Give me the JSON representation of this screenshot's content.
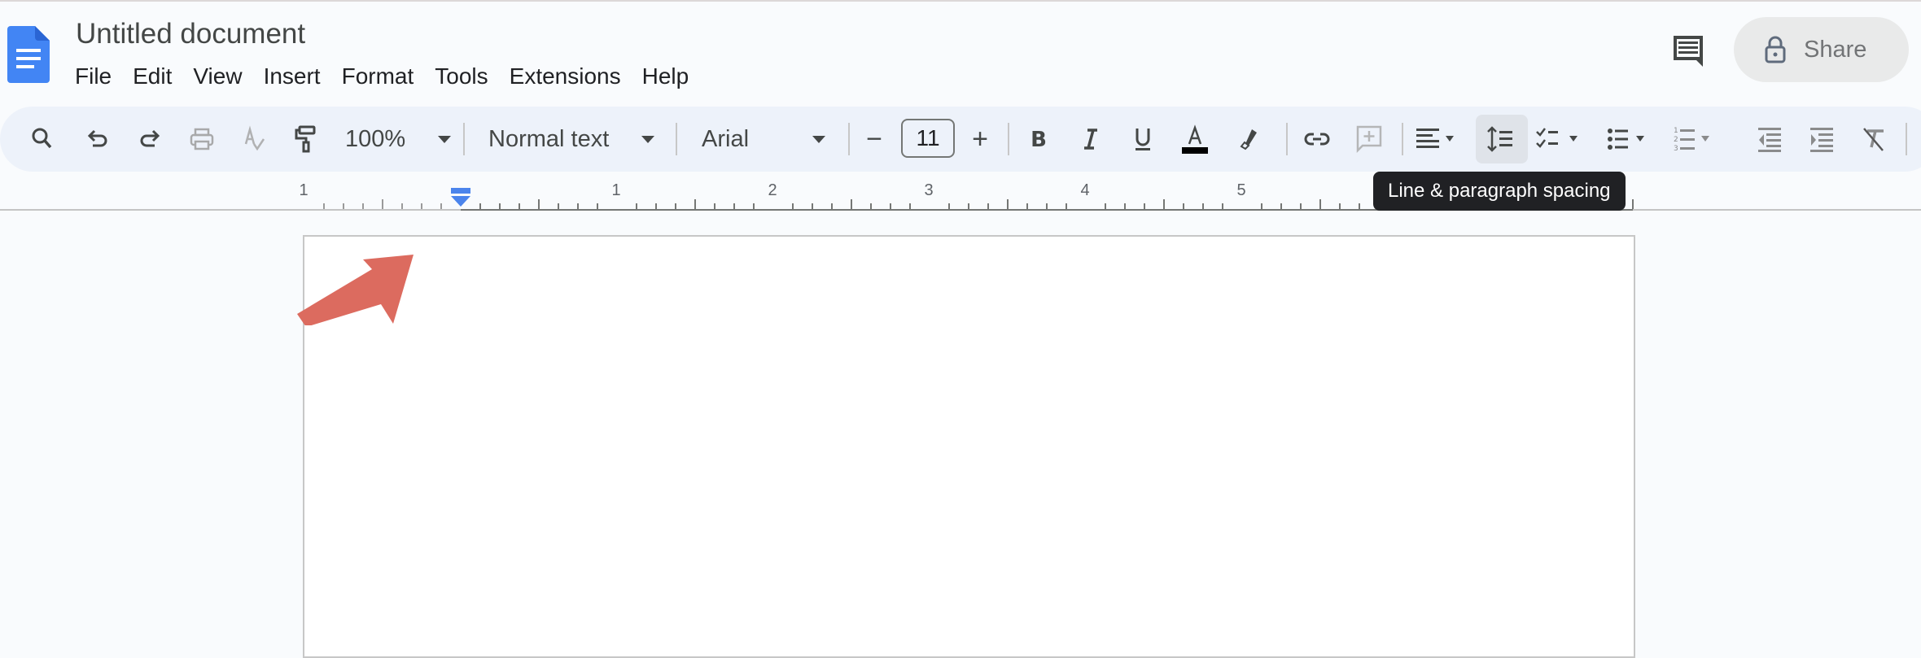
{
  "app": {
    "name": "Google Docs",
    "document_title": "Untitled document",
    "brand_color": "#4285f4"
  },
  "menubar": {
    "items": [
      "File",
      "Edit",
      "View",
      "Insert",
      "Format",
      "Tools",
      "Extensions",
      "Help"
    ]
  },
  "header": {
    "comments_icon": "comment-history-icon",
    "share_label": "Share",
    "share_icon": "lock-icon"
  },
  "toolbar": {
    "tools": [
      {
        "name": "search-menus",
        "icon": "search-icon"
      },
      {
        "name": "undo",
        "icon": "undo-icon"
      },
      {
        "name": "redo",
        "icon": "redo-icon"
      },
      {
        "name": "print",
        "icon": "print-icon",
        "disabled": true
      },
      {
        "name": "spelling-grammar",
        "icon": "spellcheck-icon",
        "disabled": true
      },
      {
        "name": "paint-format",
        "icon": "paint-format-icon"
      }
    ],
    "zoom": "100%",
    "style": "Normal text",
    "font": "Arial",
    "font_size": "11",
    "decrease_font": "−",
    "increase_font": "+",
    "text_color": "#000000",
    "format_tools": [
      "bold",
      "italic",
      "underline",
      "text-color",
      "highlight"
    ],
    "insert_tools": [
      "insert-link",
      "add-comment"
    ],
    "paragraph_tools": [
      "align-left",
      "line-paragraph-spacing",
      "checklist",
      "bulleted-list",
      "numbered-list",
      "decrease-indent",
      "increase-indent",
      "clear-formatting"
    ],
    "active_tool": "line-paragraph-spacing"
  },
  "tooltip": {
    "text": "Line & paragraph spacing"
  },
  "ruler": {
    "labels": [
      "1",
      "1",
      "2",
      "3",
      "4",
      "5"
    ],
    "unit": "inches"
  },
  "annotation": {
    "type": "arrow",
    "target": "first-line-indent-marker",
    "color": "#dc6b5f"
  }
}
